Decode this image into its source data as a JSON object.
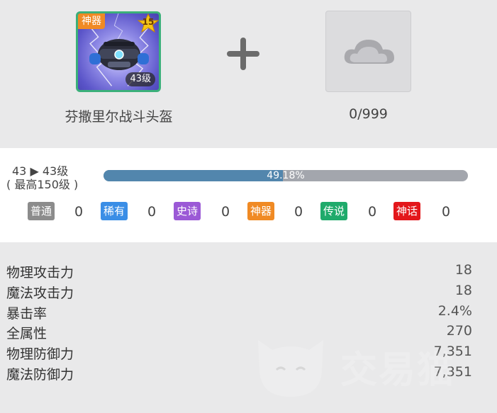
{
  "item": {
    "name": "芬撒里尔战斗头盔",
    "rarity_tag": "神器",
    "star_level": "15",
    "level_label": "43级",
    "rarity_color": "#f08a24",
    "image_icon": "helmet-icon"
  },
  "material": {
    "count": "0/999",
    "image_icon": "cloud-placeholder-icon"
  },
  "upgrade": {
    "level_line": "43 ▶ 43级",
    "max_line": "( 最高150级 )",
    "progress_text": "49.18%",
    "progress_value": 49.18
  },
  "rarity_counts": [
    {
      "label": "普通",
      "count": "0",
      "color": "#8c8c8c"
    },
    {
      "label": "稀有",
      "count": "0",
      "color": "#3a8ee6"
    },
    {
      "label": "史诗",
      "count": "0",
      "color": "#9b59d6"
    },
    {
      "label": "神器",
      "count": "0",
      "color": "#f08a24"
    },
    {
      "label": "传说",
      "count": "0",
      "color": "#1faa6b"
    },
    {
      "label": "神话",
      "count": "0",
      "color": "#e3171b"
    }
  ],
  "stats": [
    {
      "label": "物理攻击力",
      "value": "18"
    },
    {
      "label": "魔法攻击力",
      "value": "18"
    },
    {
      "label": "暴击率",
      "value": "2.4%"
    },
    {
      "label": "全属性",
      "value": "270"
    },
    {
      "label": "物理防御力",
      "value": "7,351"
    },
    {
      "label": "魔法防御力",
      "value": "7,351"
    }
  ],
  "watermark": {
    "text": "交易猫"
  }
}
